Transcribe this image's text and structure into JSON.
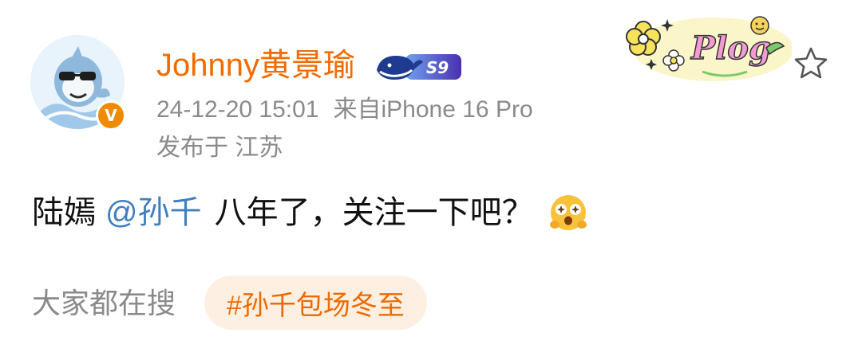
{
  "user": {
    "name": "Johnny黄景瑜",
    "avatar_icon": "cartoon-shark-avatar-icon",
    "verified_icon": "verified-v-icon",
    "verified_letter": "V",
    "vip_badge_icon": "whale-vip-badge-icon",
    "vip_badge_text": "S9"
  },
  "meta": {
    "timestamp": "24-12-20 15:01",
    "source": "来自iPhone 16 Pro",
    "location": "发布于 江苏"
  },
  "sticker": {
    "text": "Plog",
    "icon": "plog-sticker-icon"
  },
  "actions": {
    "star_icon": "star-outline-icon"
  },
  "post": {
    "text_before": "陆嫣",
    "mention": "@孙千",
    "text_after": "八年了，关注一下吧？",
    "emoji_icon": "starry-eyed-emoji-icon"
  },
  "trending": {
    "label": "大家都在搜",
    "hashtag": "#孙千包场冬至"
  },
  "colors": {
    "username": "#f26b00",
    "meta": "#8a8a8a",
    "mention": "#3f7fc0",
    "hashtag_text": "#ee6a00",
    "hashtag_bg": "#fdf0e3",
    "verified": "#f08a00"
  }
}
